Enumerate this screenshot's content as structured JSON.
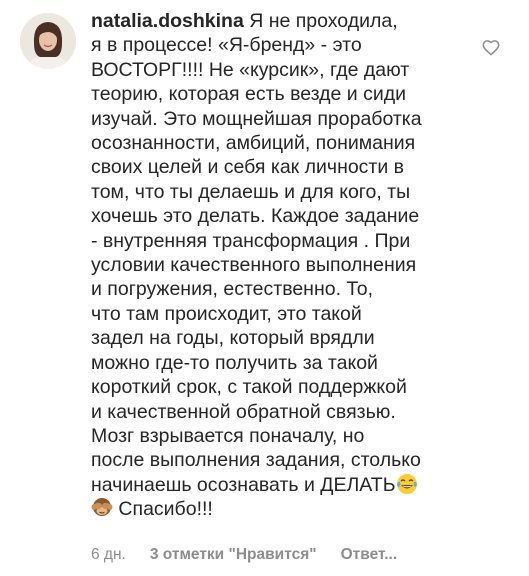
{
  "comment": {
    "username": "natalia.doshkina",
    "text_part1": "Я не проходила,\nя в процессе! «Я-бренд» - это\nВОСТОРГ!!!! Не «курсик», где дают\nтеорию, которая есть везде и сиди\nизучай. Это мощнейшая проработка\nосознанности, амбиций, понимания\nсвоих целей и себя как личности в\nтом, что ты делаешь и для кого, ты\nхочешь это делать. Каждое задание\n- внутренняя трансформация . При\nусловии качественного выполнения\nи погружения, естественно. То,\nчто там происходит, это такой\nзадел на годы, который врядли\nможно где-то получить за такой\nкороткий срок, с такой поддержкой\nи качественной обратной связью.\nМозг взрывается поначалу, но\nпосле выполнения задания, столько\nначинаешь осознавать и ДЕЛАТЬ",
    "text_part2": "Спасибо!!!",
    "emoji_1": "face-with-tears-of-joy-icon",
    "emoji_2": "see-no-evil-monkey-icon",
    "time": "6 дн.",
    "likes": "3 отметки \"Нравится\"",
    "reply": "Ответ..."
  },
  "colors": {
    "text": "#262626",
    "meta": "#8e8e8e",
    "heart_stroke": "#8e8e8e"
  }
}
